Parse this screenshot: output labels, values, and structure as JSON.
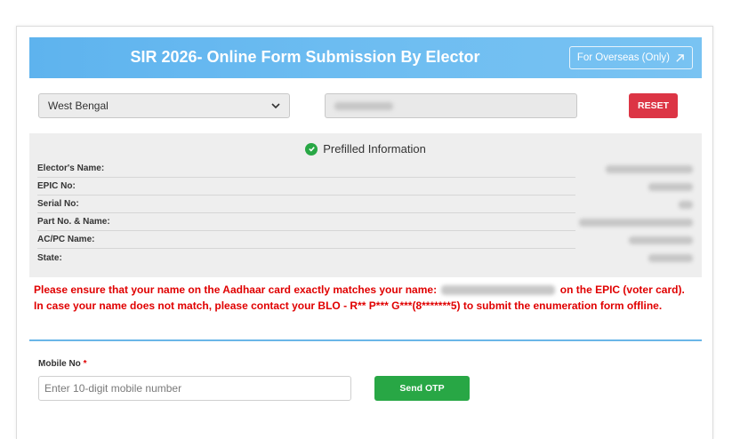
{
  "header": {
    "title": "SIR 2026- Online Form Submission By Elector",
    "overseas_label": "For Overseas (Only)"
  },
  "filters": {
    "state_selected": "West Bengal",
    "reset_label": "RESET"
  },
  "prefilled": {
    "title": "Prefilled Information",
    "rows": [
      {
        "label": "Elector's Name:"
      },
      {
        "label": "EPIC No:"
      },
      {
        "label": "Serial No:"
      },
      {
        "label": "Part No. & Name:"
      },
      {
        "label": "AC/PC Name:"
      },
      {
        "label": "State:"
      }
    ]
  },
  "warning": {
    "line1_pre": "Please ensure that your name on the Aadhaar card exactly matches your name:",
    "line1_post": "on the EPIC (voter card).",
    "line2": "In case your name does not match, please contact your BLO - R** P*** G***(8*******5) to submit the enumeration form offline."
  },
  "mobile": {
    "label": "Mobile No",
    "required_mark": "*",
    "placeholder": "Enter 10-digit mobile number",
    "send_label": "Send OTP"
  },
  "colors": {
    "header_gradient_start": "#5eb3ee",
    "reset": "#dc3545",
    "success": "#28a745",
    "warning_text": "#e00000",
    "divider": "#6ab6e8"
  },
  "icons": {
    "overseas": "external-link-icon",
    "select": "chevron-down-icon",
    "prefilled": "check-circle-icon"
  }
}
